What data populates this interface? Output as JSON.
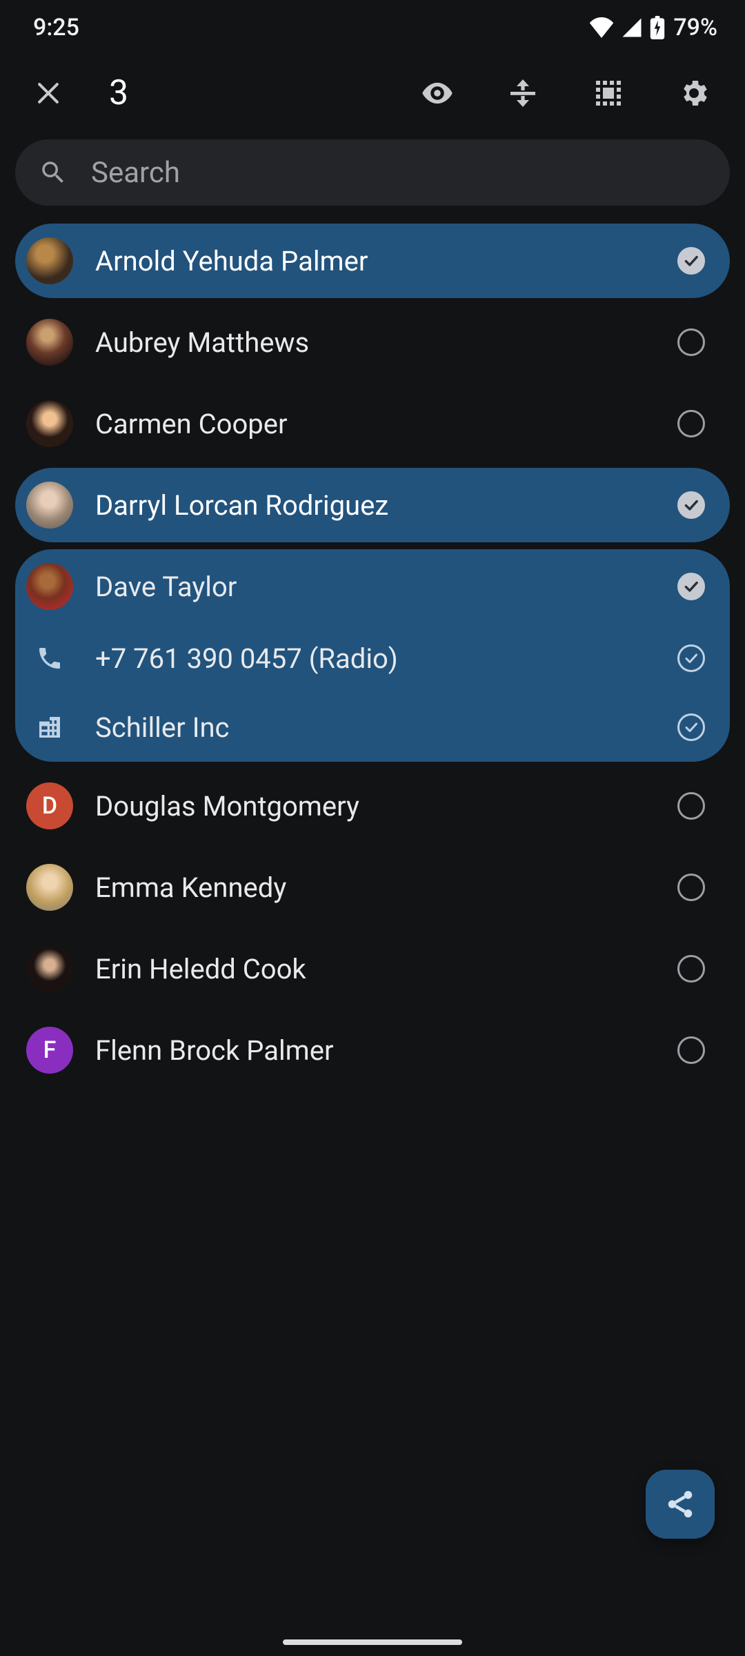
{
  "status": {
    "time": "9:25",
    "battery": "79%"
  },
  "appbar": {
    "count": "3"
  },
  "search": {
    "placeholder": "Search"
  },
  "contacts": {
    "arnold": {
      "name": "Arnold Yehuda Palmer"
    },
    "aubrey": {
      "name": "Aubrey Matthews"
    },
    "carmen": {
      "name": "Carmen Cooper"
    },
    "darryl": {
      "name": "Darryl Lorcan Rodriguez"
    },
    "dave": {
      "name": "Dave Taylor",
      "phone": "+7 761 390 0457 (Radio)",
      "org": "Schiller Inc"
    },
    "douglas": {
      "name": "Douglas Montgomery",
      "initial": "D"
    },
    "emma": {
      "name": "Emma Kennedy"
    },
    "erin": {
      "name": "Erin Heledd Cook"
    },
    "flenn": {
      "name": "Flenn Brock Palmer",
      "initial": "F"
    }
  }
}
